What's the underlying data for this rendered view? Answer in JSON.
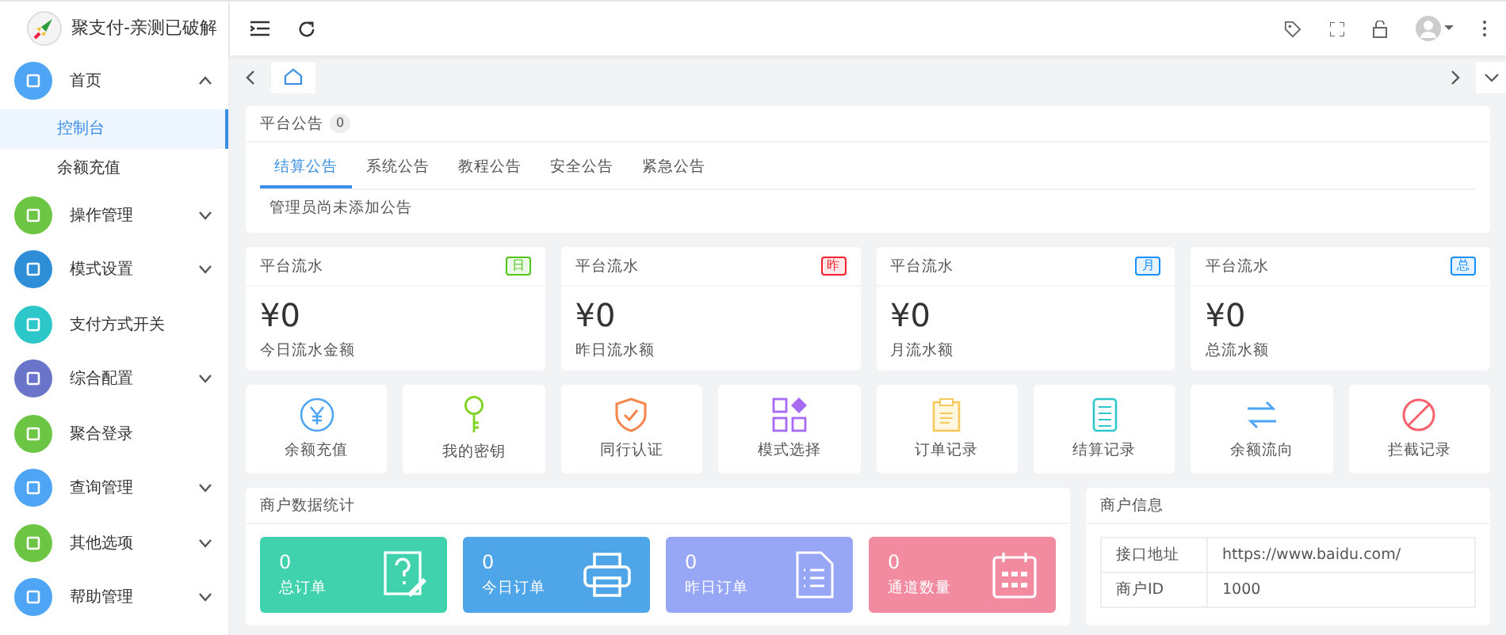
{
  "brand": {
    "title": "聚支付-亲测已破解"
  },
  "sidebar": {
    "items": [
      {
        "label": "首页",
        "kind": "group",
        "expanded": true,
        "color": "#4ea5f5",
        "children": [
          {
            "label": "控制台",
            "selected": true
          },
          {
            "label": "余额充值",
            "selected": false
          }
        ]
      },
      {
        "label": "操作管理",
        "kind": "group",
        "expanded": false,
        "color": "#6cc644"
      },
      {
        "label": "模式设置",
        "kind": "group",
        "expanded": false,
        "color": "#2f8ed8"
      },
      {
        "label": "支付方式开关",
        "kind": "link",
        "color": "#2ec7c9"
      },
      {
        "label": "综合配置",
        "kind": "group",
        "expanded": false,
        "color": "#6a75c9"
      },
      {
        "label": "聚合登录",
        "kind": "link",
        "color": "#6cc644"
      },
      {
        "label": "查询管理",
        "kind": "group",
        "expanded": false,
        "color": "#4ea5f5"
      },
      {
        "label": "其他选项",
        "kind": "group",
        "expanded": false,
        "color": "#6cc644"
      },
      {
        "label": "帮助管理",
        "kind": "group",
        "expanded": false,
        "color": "#4ea5f5"
      }
    ]
  },
  "notice": {
    "title": "平台公告",
    "count": "0",
    "tabs": [
      {
        "label": "结算公告",
        "selected": true
      },
      {
        "label": "系统公告",
        "selected": false
      },
      {
        "label": "教程公告",
        "selected": false
      },
      {
        "label": "安全公告",
        "selected": false
      },
      {
        "label": "紧急公告",
        "selected": false
      }
    ],
    "empty_text": "管理员尚未添加公告"
  },
  "flow_cards": [
    {
      "title": "平台流水",
      "badge": "日",
      "color": "#52c41a",
      "amount": "¥0",
      "caption": "今日流水金额"
    },
    {
      "title": "平台流水",
      "badge": "昨",
      "color": "#f5222d",
      "amount": "¥0",
      "caption": "昨日流水额"
    },
    {
      "title": "平台流水",
      "badge": "月",
      "color": "#1890ff",
      "amount": "¥0",
      "caption": "月流水额"
    },
    {
      "title": "平台流水",
      "badge": "总",
      "color": "#1890ff",
      "amount": "¥0",
      "caption": "总流水额"
    }
  ],
  "shortcuts": [
    {
      "label": "余额充值",
      "kind": "yen"
    },
    {
      "label": "我的密钥",
      "kind": "key"
    },
    {
      "label": "同行认证",
      "kind": "shield"
    },
    {
      "label": "模式选择",
      "kind": "grid"
    },
    {
      "label": "订单记录",
      "kind": "clipboard"
    },
    {
      "label": "结算记录",
      "kind": "list"
    },
    {
      "label": "余额流向",
      "kind": "flow"
    },
    {
      "label": "拦截记录",
      "kind": "block"
    }
  ],
  "merchant_stats": {
    "title": "商户数据统计",
    "tiles": [
      {
        "value": "0",
        "label": "总订单",
        "color": "#3fd2ad",
        "kind": "note"
      },
      {
        "value": "0",
        "label": "今日订单",
        "color": "#4ea5e8",
        "kind": "printer"
      },
      {
        "value": "0",
        "label": "昨日订单",
        "color": "#98a6f6",
        "kind": "doc"
      },
      {
        "value": "0",
        "label": "通道数量",
        "color": "#f28ba0",
        "kind": "calendar"
      }
    ]
  },
  "merchant_info": {
    "title": "商户信息",
    "rows": [
      {
        "key": "接口地址",
        "value": "https://www.baidu.com/"
      },
      {
        "key": "商户ID",
        "value": "1000"
      }
    ]
  }
}
